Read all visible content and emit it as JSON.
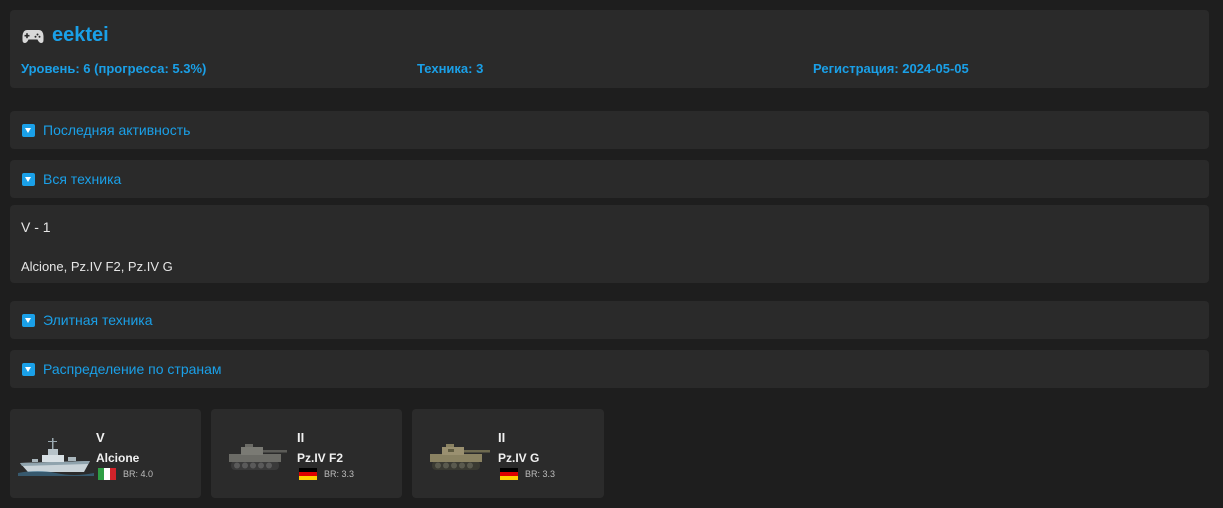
{
  "profile": {
    "icon": "gamepad-icon",
    "username": "eektei",
    "level_text": "Уровень: 6 (прогресса: 5.3%)",
    "vehicles_text": "Техника: 3",
    "registration_text": "Регистрация: 2024-05-05",
    "accent_color": "#1aa0e8"
  },
  "sections": {
    "recent_activity": "Последняя активность",
    "all_vehicles": "Вся техника",
    "elite_vehicles": "Элитная техника",
    "by_country": "Распределение по странам"
  },
  "all_vehicles_content": {
    "tier_line": "V - 1",
    "vehicle_list": "Alcione, Pz.IV F2, Pz.IV G"
  },
  "cards": [
    {
      "tier": "V",
      "name": "Alcione",
      "br": "BR: 4.0",
      "flag": "italy-flag",
      "thumb": "ship-icon"
    },
    {
      "tier": "II",
      "name": "Pz.IV F2",
      "br": "BR: 3.3",
      "flag": "germany-flag",
      "thumb": "tank-icon"
    },
    {
      "tier": "II",
      "name": "Pz.IV G",
      "br": "BR: 3.3",
      "flag": "germany-flag",
      "thumb": "tank-icon"
    }
  ]
}
